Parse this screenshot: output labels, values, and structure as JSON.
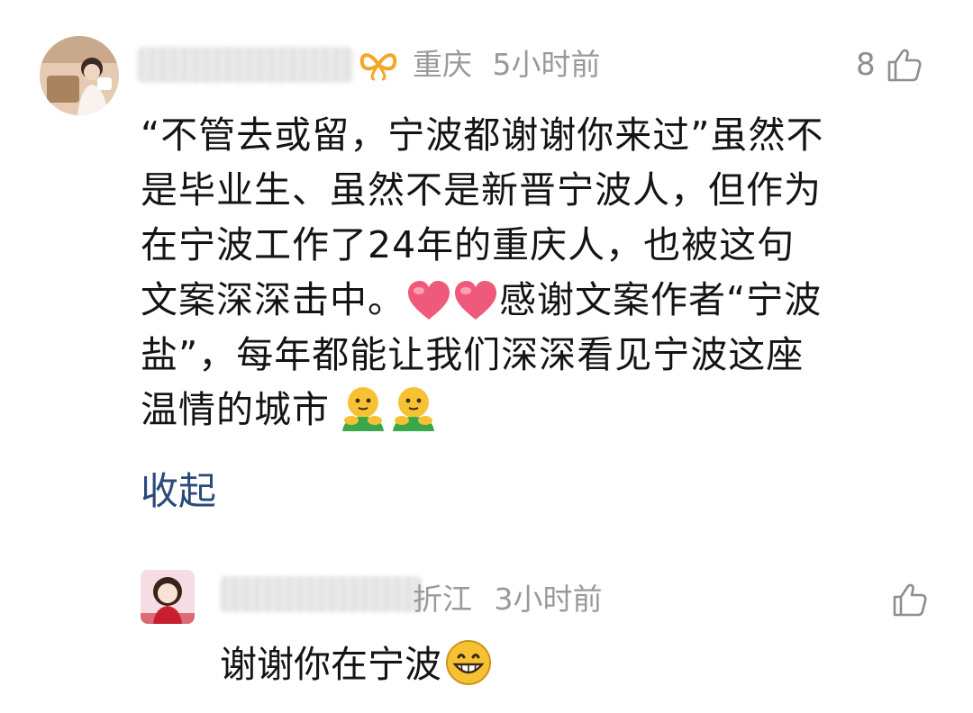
{
  "comment": {
    "author_name": "",
    "location": "重庆",
    "time": "5小时前",
    "like_count": "8",
    "text_lines": [
      "“不管去或留，宁波都谢谢你来过”虽然不",
      "是毕业生、虽然不是新晋宁波人，但作为",
      "在宁波工作了24年的重庆人，也被这句",
      "文案深深击中。",
      "感谢文案作者“宁波",
      "盐”，每年都能让我们深深看见宁波这座",
      "温情的城市"
    ],
    "emojis": [
      "heart-emoji",
      "heart-emoji",
      "hug-emoji",
      "hug-emoji"
    ],
    "collapse_label": "收起"
  },
  "reply": {
    "author_name": "",
    "location_partial": "折江",
    "time": "3小时前",
    "text": "谢谢你在宁波",
    "emoji": "grin-emoji"
  },
  "colors": {
    "meta_gray": "#9a9a9a",
    "body_text": "#141414",
    "link_blue": "#2a4a7a",
    "badge_orange": "#f5a623",
    "heart_pink": "#f05a7a",
    "emoji_yellow": "#f6c233",
    "emoji_green": "#3aa84a"
  }
}
